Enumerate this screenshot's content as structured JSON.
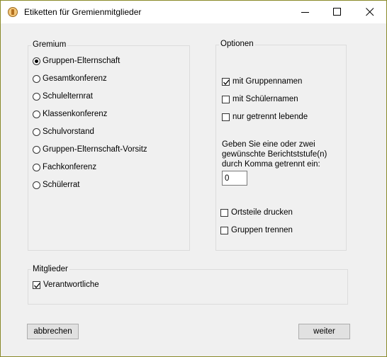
{
  "window": {
    "title": "Etiketten für Gremienmitglieder"
  },
  "gremium": {
    "title": "Gremium",
    "options": [
      {
        "label": "Gruppen-Elternschaft",
        "checked": true
      },
      {
        "label": "Gesamtkonferenz",
        "checked": false
      },
      {
        "label": "Schulelternrat",
        "checked": false
      },
      {
        "label": "Klassenkonferenz",
        "checked": false
      },
      {
        "label": "Schulvorstand",
        "checked": false
      },
      {
        "label": "Gruppen-Elternschaft-Vorsitz",
        "checked": false
      },
      {
        "label": "Fachkonferenz",
        "checked": false
      },
      {
        "label": "Schülerrat",
        "checked": false
      }
    ]
  },
  "optionen": {
    "title": "Optionen",
    "mit_gruppennamen": {
      "label": "mit Gruppennamen",
      "checked": true
    },
    "mit_schuelernamen": {
      "label": "mit Schülernamen",
      "checked": false
    },
    "nur_getrennt": {
      "label": "nur getrennt lebende",
      "checked": false
    },
    "stufe_prompt": [
      "Geben Sie eine oder zwei",
      "gewünschte Berichtststufe(n)",
      "durch Komma getrennt ein:"
    ],
    "stufe_value": "0",
    "ortsteile": {
      "label": "Ortsteile drucken",
      "checked": false
    },
    "gruppen_trennen": {
      "label": "Gruppen trennen",
      "checked": false
    }
  },
  "mitglieder": {
    "title": "Mitglieder",
    "verantwortliche": {
      "label": "Verantwortliche",
      "checked": true
    }
  },
  "buttons": {
    "cancel": "abbrechen",
    "next": "weiter"
  }
}
